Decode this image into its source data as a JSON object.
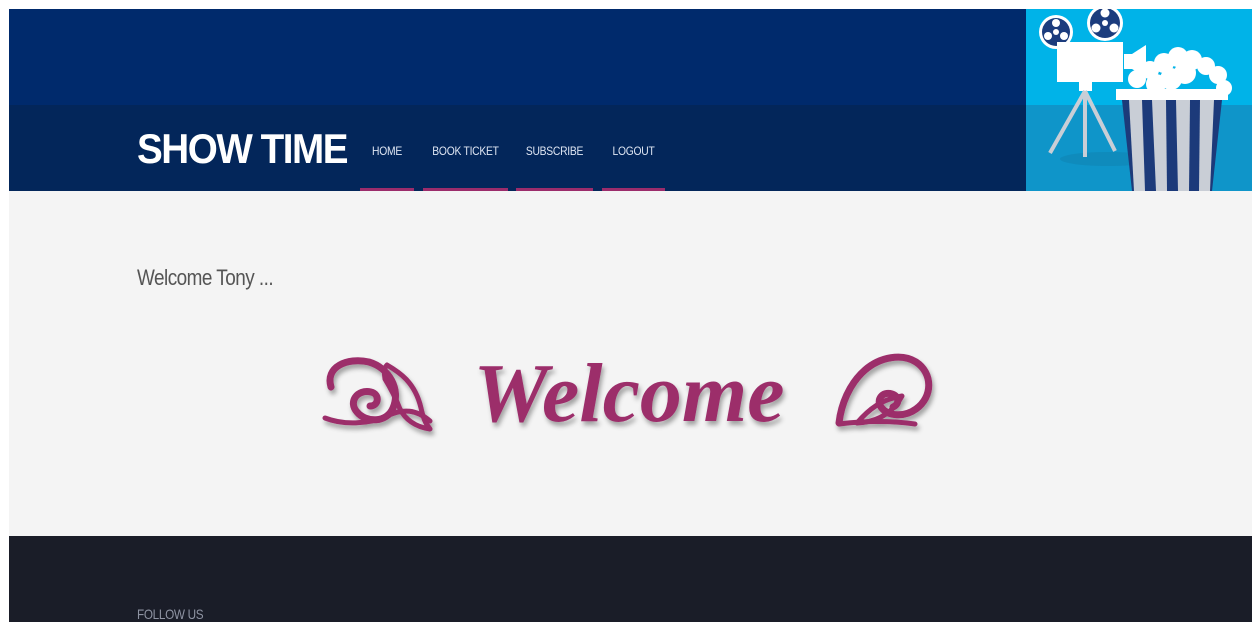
{
  "brand": {
    "name": "SHOW TIME"
  },
  "nav": {
    "items": [
      {
        "label": "HOME"
      },
      {
        "label": "BOOK TICKET"
      },
      {
        "label": "SUBSCRIBE"
      },
      {
        "label": "LOGOUT"
      }
    ]
  },
  "main": {
    "greeting": "Welcome Tony ...",
    "banner_text": "Welcome"
  },
  "footer": {
    "follow_label": "FOLLOW US"
  },
  "colors": {
    "header_blue": "#002a6c",
    "header_band": "#03265a",
    "accent_pink": "#9b2c6b",
    "content_bg": "#f4f4f4",
    "footer_bg": "#1a1d28",
    "hero_sky": "#00b3e8"
  },
  "icons": {
    "hero": "film-camera-popcorn-icon"
  }
}
